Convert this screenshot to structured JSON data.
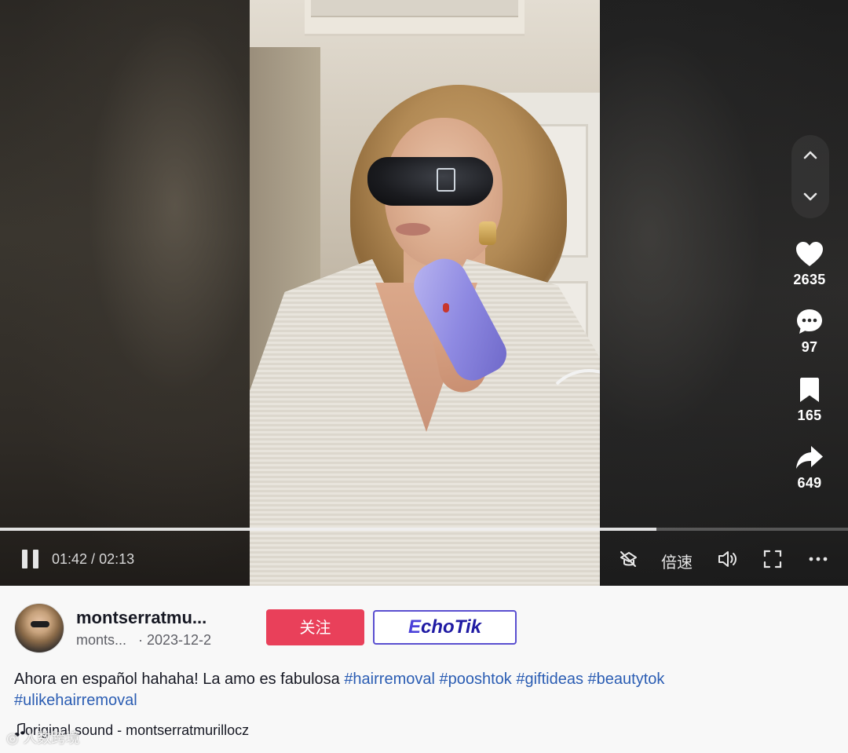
{
  "player": {
    "current_time": "01:42",
    "total_time": "02:13",
    "time_separator": " / ",
    "progress_fraction": 0.774,
    "speed_label": "倍速"
  },
  "actions": {
    "likes": "2635",
    "comments": "97",
    "saves": "165",
    "shares": "649"
  },
  "author": {
    "username": "montserratmu...",
    "handle": "monts...",
    "date": "· 2023-12-2"
  },
  "buttons": {
    "follow_label": "关注",
    "echotik_label": "EchoTik"
  },
  "caption": {
    "text": "Ahora en español hahaha! La amo es fabulosa ",
    "hashtags": [
      "#hairremoval",
      "#pooshtok",
      "#giftideas",
      "#beautytok",
      "#ulikehairremoval"
    ]
  },
  "sound": {
    "label": "original sound - montserratmurillocz"
  },
  "watermark": {
    "text": "人数跨境"
  },
  "icons": [
    "chevron-up-icon",
    "chevron-down-icon",
    "heart-icon",
    "comment-icon",
    "bookmark-icon",
    "share-icon",
    "pause-icon",
    "mini-player-icon",
    "volume-icon",
    "fullscreen-icon",
    "more-icon",
    "music-note-icon"
  ],
  "colors": {
    "follow": "#e9405a",
    "hashtag": "#2b5db3",
    "echotik_border": "#5a4fd0"
  }
}
